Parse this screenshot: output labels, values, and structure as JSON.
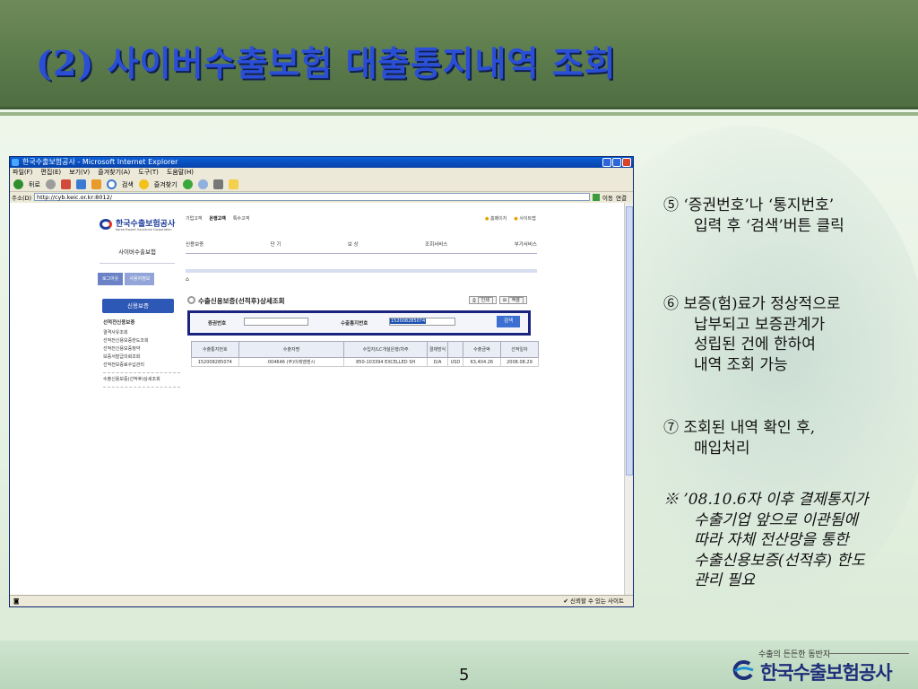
{
  "slide": {
    "title": "(2) 사이버수출보험 대출통지내역 조회",
    "page_number": "5",
    "footer_tagline": "수출의 든든한 동반자",
    "footer_company": "한국수출보험공사"
  },
  "browser": {
    "window_title": "한국수출보험공사 - Microsoft Internet Explorer",
    "menu": [
      "파일(F)",
      "편집(E)",
      "보기(V)",
      "즐겨찾기(A)",
      "도구(T)",
      "도움말(H)"
    ],
    "toolbar": {
      "back": "뒤로",
      "search": "검색",
      "favorites": "즐겨찾기"
    },
    "address_label": "주소(D)",
    "address": "http://cyb.keic.or.kr:8012/",
    "go_label": "이동",
    "links_label": "연결",
    "status_zone": "신뢰할 수 있는 사이트"
  },
  "site": {
    "logo_ko": "한국수출보험공사",
    "logo_en": "Korea Export Insurance Corporation",
    "top_nav": [
      "기업고객",
      "은행고객",
      "특수고객"
    ],
    "top_links": [
      "홈페이지",
      "사이트맵"
    ],
    "main_menu": [
      "신용보증",
      "단 기",
      "보 상",
      "조회서비스",
      "부가서비스"
    ],
    "sidebar_title": "사이버수출보험",
    "logout_label": "로그아웃",
    "user_info_label": "사용자정보",
    "credit_button": "신용보증",
    "side_list": {
      "head": "선적전신용보증",
      "items": [
        "결격사유조회",
        "선적전신용보증한도조회",
        "선적전신용보증청약",
        "보증서발급의뢰조회"
      ],
      "item_last": "선적전보증료수납관리",
      "item_after": "수출신용보증(선적후)상세조회"
    },
    "content_title": "수출신용보증(선적후)상세조회",
    "print_label": "인쇄",
    "excel_label": "엑셀",
    "search": {
      "cert_label": "증권번호",
      "cert_value": "",
      "notice_label": "수출통지번호",
      "notice_value": "152008285074",
      "button": "검색"
    },
    "table": {
      "headers": [
        "수출통지번호",
        "수출자명",
        "수입자/LC개설은행/차주",
        "결제방식",
        "",
        "수출금액",
        "선적일자"
      ],
      "rows": [
        [
          "152008285074",
          "004646 (주)이레엠앤시",
          "850-103394 EXCELLED SH",
          "D/A",
          "USD",
          "63,404.26",
          "2008.08.29"
        ]
      ]
    }
  },
  "notes": [
    {
      "marker": "⑤",
      "lines": [
        "‘증권번호’나 ‘통지번호’",
        "입력 후 ‘검색’버튼 클릭"
      ]
    },
    {
      "marker": "⑥",
      "lines": [
        "보증(험)료가 정상적으로",
        "납부되고 보증관계가",
        "성립된 건에 한하여",
        "내역 조회 가능"
      ]
    },
    {
      "marker": "⑦",
      "lines": [
        "조회된 내역 확인 후,",
        "매입처리"
      ]
    },
    {
      "marker": "※",
      "lines": [
        "’08.10.6자 이후 결제통지가",
        "수출기업 앞으로 이관됨에",
        "따라 자체 전산망을 통한",
        "수출신용보증(선적후) 한도",
        "관리 필요"
      ]
    }
  ],
  "colors": {
    "title_blue": "#2a4fd6",
    "header_green": "#5d7d4d",
    "highlight_box": "#1a237e",
    "search_button": "#3b6fd1"
  }
}
